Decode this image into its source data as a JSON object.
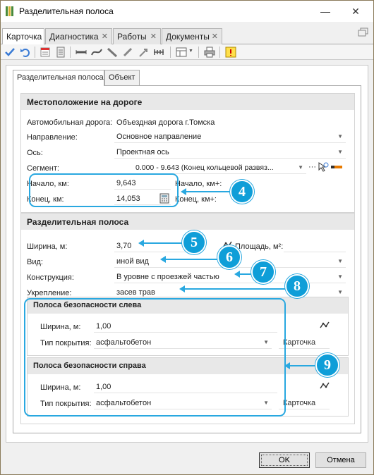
{
  "window": {
    "title": "Разделительная полоса",
    "minimize": "—",
    "close": "✕"
  },
  "tabs": [
    {
      "label": "Карточка",
      "closable": false
    },
    {
      "label": "Диагностика",
      "closable": true
    },
    {
      "label": "Работы",
      "closable": true
    },
    {
      "label": "Документы",
      "closable": true
    }
  ],
  "inner_tabs": [
    "Разделительная полоса",
    "Объект"
  ],
  "location": {
    "header": "Местоположение на дороге",
    "road_label": "Автомобильная дорога:",
    "road_value": "Объездная дорога г.Томска",
    "direction_label": "Направление:",
    "direction_value": "Основное направление",
    "axis_label": "Ось:",
    "axis_value": "Проектная ось",
    "segment_label": "Сегмент:",
    "segment_value": "0.000 -      9.643 (Конец кольцевой развяз...",
    "segment_more": "···",
    "start_km_label": "Начало, км:",
    "start_km_value": "9,643",
    "end_km_label": "Конец, км:",
    "end_km_value": "14,053",
    "start_kmplus_label": "Начало, км+:",
    "end_kmplus_label": "Конец, км+:"
  },
  "strip": {
    "header": "Разделительная полоса",
    "width_label": "Ширина, м:",
    "width_value": "3,70",
    "area_label": "Площадь, м²:",
    "type_label": "Вид:",
    "type_value": "иной вид",
    "construction_label": "Конструкция:",
    "construction_value": "В уровне с проезжей частью",
    "reinforcement_label": "Укрепление:",
    "reinforcement_value": "засев трав"
  },
  "safety_left": {
    "header": "Полоса безопасности слева",
    "width_label": "Ширина, м:",
    "width_value": "1,00",
    "surface_label": "Тип покрытия:",
    "surface_value": "асфальтобетон",
    "card": "Карточка"
  },
  "safety_right": {
    "header": "Полоса безопасности справа",
    "width_label": "Ширина, м:",
    "width_value": "1,00",
    "surface_label": "Тип покрытия:",
    "surface_value": "асфальтобетон",
    "card": "Карточка"
  },
  "badges": [
    "4",
    "5",
    "6",
    "7",
    "8",
    "9"
  ],
  "buttons": {
    "ok": "OK",
    "cancel": "Отмена"
  },
  "colors": {
    "callout": "#29a8e0",
    "badge": "#0f9ed8",
    "header_bg": "#e8e8e8"
  }
}
